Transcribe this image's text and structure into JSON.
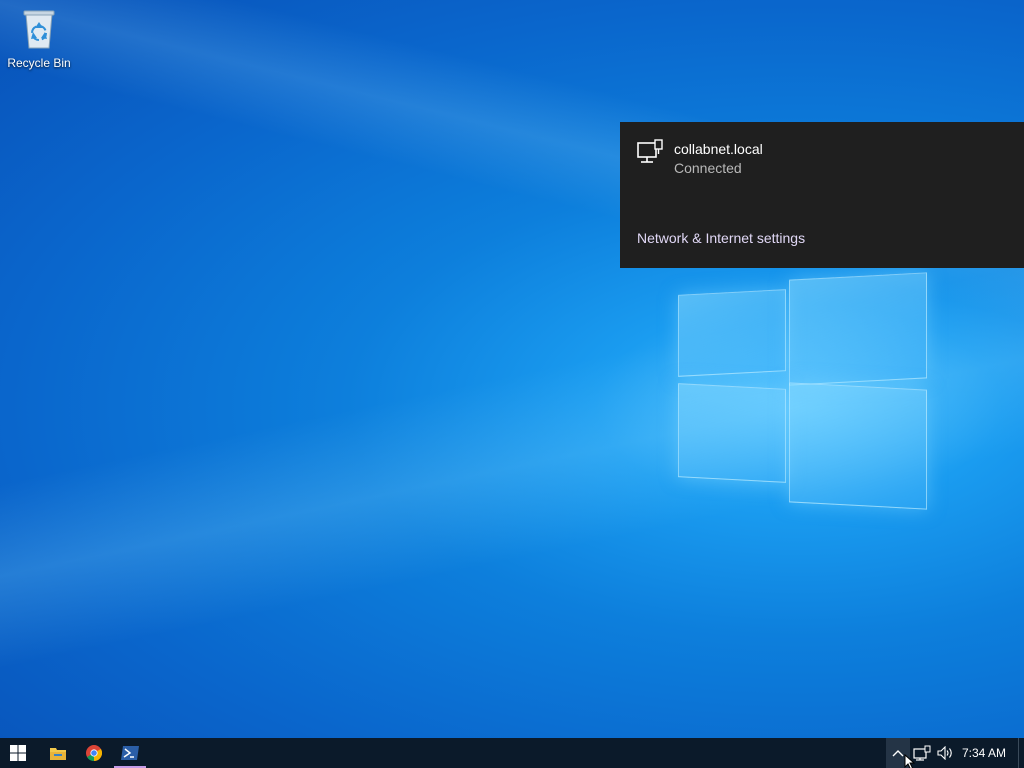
{
  "desktop": {
    "icons": [
      {
        "label": "Recycle Bin",
        "icon": "recycle-bin-icon"
      }
    ]
  },
  "network_flyout": {
    "network_name": "collabnet.local",
    "network_status": "Connected",
    "settings_link": "Network & Internet settings",
    "icon": "wired-network-icon"
  },
  "taskbar": {
    "apps": [
      {
        "name": "Start",
        "icon": "windows-start-icon"
      },
      {
        "name": "File Explorer",
        "icon": "file-explorer-icon"
      },
      {
        "name": "Google Chrome",
        "icon": "chrome-icon"
      },
      {
        "name": "PowerShell",
        "icon": "powershell-icon",
        "active": true
      }
    ],
    "tray": {
      "chevron_icon": "chevron-up-icon",
      "network_icon": "network-icon",
      "volume_icon": "volume-icon",
      "time": "7:34 AM"
    }
  },
  "colors": {
    "taskbar_bg": "#0b1a2a",
    "flyout_bg": "#1f1f1f",
    "active_indicator": "#c49ce8",
    "link_color": "#e0d7f5"
  }
}
